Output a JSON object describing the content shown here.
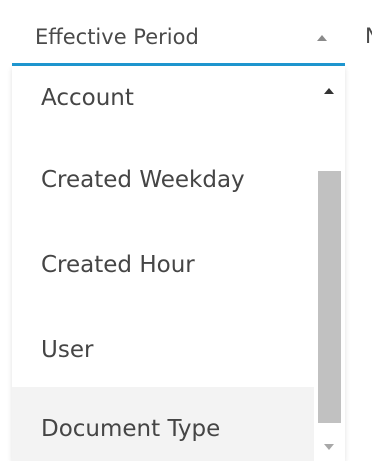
{
  "select": {
    "selected_value": "Effective Period",
    "adjacent_label_fragment": "N",
    "accent_color": "#1f97d1",
    "arrow_icon": "chevron-up-icon"
  },
  "dropdown": {
    "options": [
      {
        "label": "Account"
      },
      {
        "label": "Created Weekday"
      },
      {
        "label": "Created Hour"
      },
      {
        "label": "User"
      },
      {
        "label": "Document Type",
        "highlighted": true
      }
    ],
    "scrollbar": {
      "up_icon": "scroll-up-arrow-icon",
      "down_icon": "scroll-down-arrow-icon"
    }
  }
}
